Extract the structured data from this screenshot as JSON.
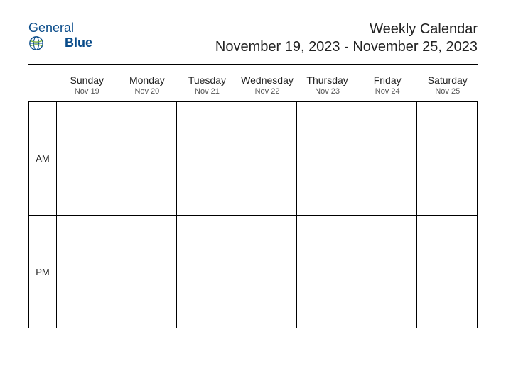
{
  "logo": {
    "text_general": "General",
    "text_blue": "Blue"
  },
  "header": {
    "title": "Weekly Calendar",
    "date_range": "November 19, 2023 - November 25, 2023"
  },
  "days": [
    {
      "name": "Sunday",
      "date": "Nov 19"
    },
    {
      "name": "Monday",
      "date": "Nov 20"
    },
    {
      "name": "Tuesday",
      "date": "Nov 21"
    },
    {
      "name": "Wednesday",
      "date": "Nov 22"
    },
    {
      "name": "Thursday",
      "date": "Nov 23"
    },
    {
      "name": "Friday",
      "date": "Nov 24"
    },
    {
      "name": "Saturday",
      "date": "Nov 25"
    }
  ],
  "time_periods": [
    {
      "label": "AM"
    },
    {
      "label": "PM"
    }
  ]
}
